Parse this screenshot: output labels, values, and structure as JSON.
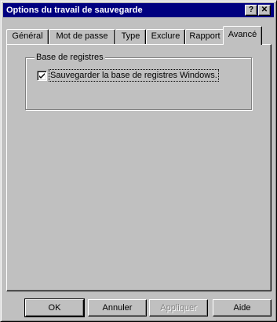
{
  "window": {
    "title": "Options du travail de sauvegarde",
    "help_button": "?",
    "close_button": "✕"
  },
  "tabs": [
    {
      "label": "Général",
      "active": false
    },
    {
      "label": "Mot de passe",
      "active": false
    },
    {
      "label": "Type",
      "active": false
    },
    {
      "label": "Exclure",
      "active": false
    },
    {
      "label": "Rapport",
      "active": false
    },
    {
      "label": "Avancé",
      "active": true
    }
  ],
  "registry_group": {
    "label": "Base de registres",
    "checkbox": {
      "label": "Sauvegarder la base de registres Windows.",
      "checked": true
    }
  },
  "buttons": {
    "ok": "OK",
    "cancel": "Annuler",
    "apply": "Appliquer",
    "help": "Aide"
  }
}
